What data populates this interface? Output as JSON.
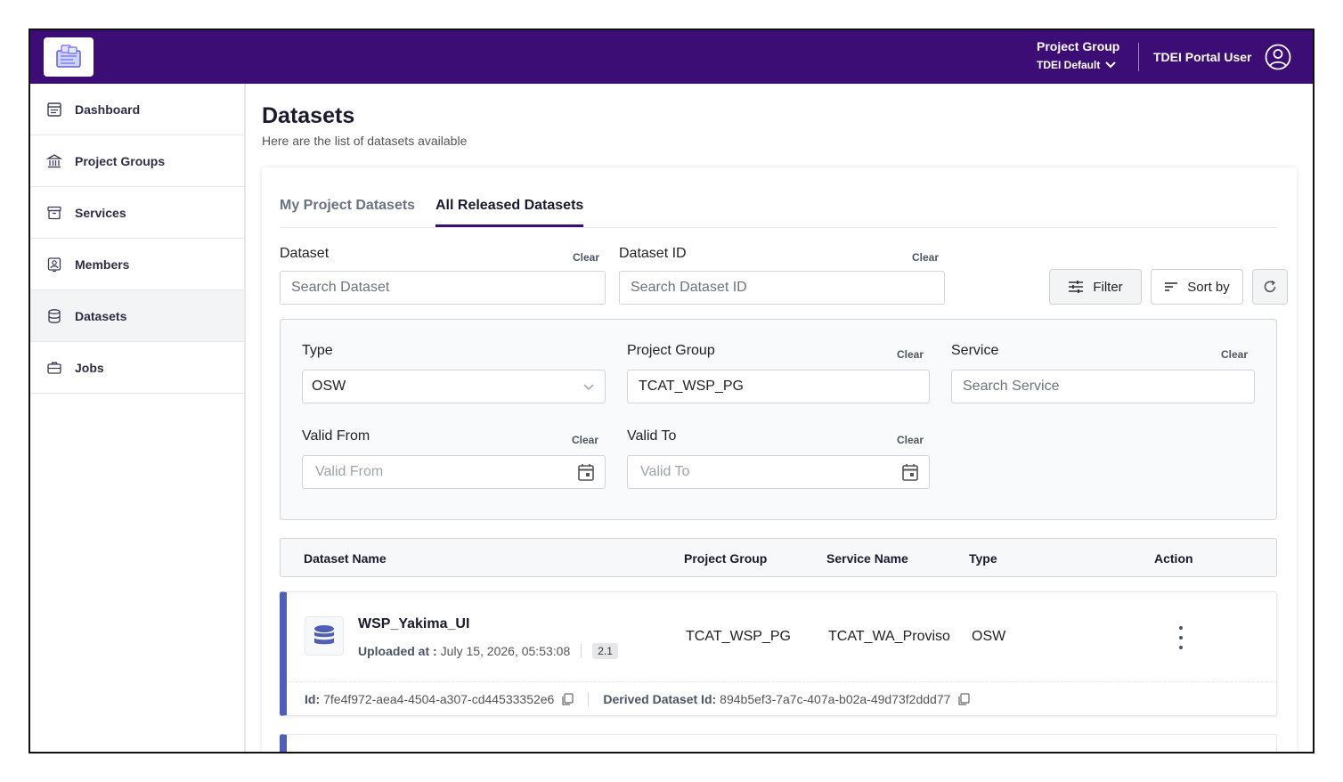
{
  "header": {
    "project_group_label": "Project Group",
    "project_group_value": "TDEI Default",
    "user_name": "TDEI Portal User"
  },
  "sidebar": {
    "items": [
      {
        "label": "Dashboard",
        "icon": "dashboard-icon"
      },
      {
        "label": "Project Groups",
        "icon": "bank-icon"
      },
      {
        "label": "Services",
        "icon": "archive-icon"
      },
      {
        "label": "Members",
        "icon": "member-badge-icon"
      },
      {
        "label": "Datasets",
        "icon": "database-icon",
        "active": true
      },
      {
        "label": "Jobs",
        "icon": "briefcase-icon"
      }
    ]
  },
  "page": {
    "title": "Datasets",
    "subtitle": "Here are the list of datasets available"
  },
  "tabs": [
    {
      "label": "My Project Datasets",
      "active": false
    },
    {
      "label": "All Released Datasets",
      "active": true
    }
  ],
  "search": {
    "dataset_label": "Dataset",
    "dataset_placeholder": "Search Dataset",
    "dataset_id_label": "Dataset ID",
    "dataset_id_placeholder": "Search Dataset ID",
    "clear_label": "Clear"
  },
  "toolbar": {
    "filter_label": "Filter",
    "sort_label": "Sort by"
  },
  "filters": {
    "type_label": "Type",
    "type_value": "OSW",
    "project_group_label": "Project Group",
    "project_group_value": "TCAT_WSP_PG",
    "service_label": "Service",
    "service_placeholder": "Search Service",
    "valid_from_label": "Valid From",
    "valid_from_placeholder": "Valid From",
    "valid_to_label": "Valid To",
    "valid_to_placeholder": "Valid To",
    "clear_label": "Clear"
  },
  "table": {
    "columns": [
      "Dataset Name",
      "Project Group",
      "Service Name",
      "Type",
      "Action"
    ],
    "rows": [
      {
        "name": "WSP_Yakima_UI",
        "uploaded_label": "Uploaded at :",
        "uploaded_value": "July 15, 2026, 05:53:08",
        "version": "2.1",
        "project_group": "TCAT_WSP_PG",
        "service": "TCAT_WA_Proviso",
        "type": "OSW",
        "id_label": "Id:",
        "id_value": "7fe4f972-aea4-4504-a307-cd44533352e6",
        "derived_label": "Derived Dataset Id:",
        "derived_value": "894b5ef3-7a7c-407a-b02a-49d73f2ddd77"
      }
    ]
  },
  "colors": {
    "brand": "#3c0e75",
    "row_accent": "#4f5fb8"
  }
}
